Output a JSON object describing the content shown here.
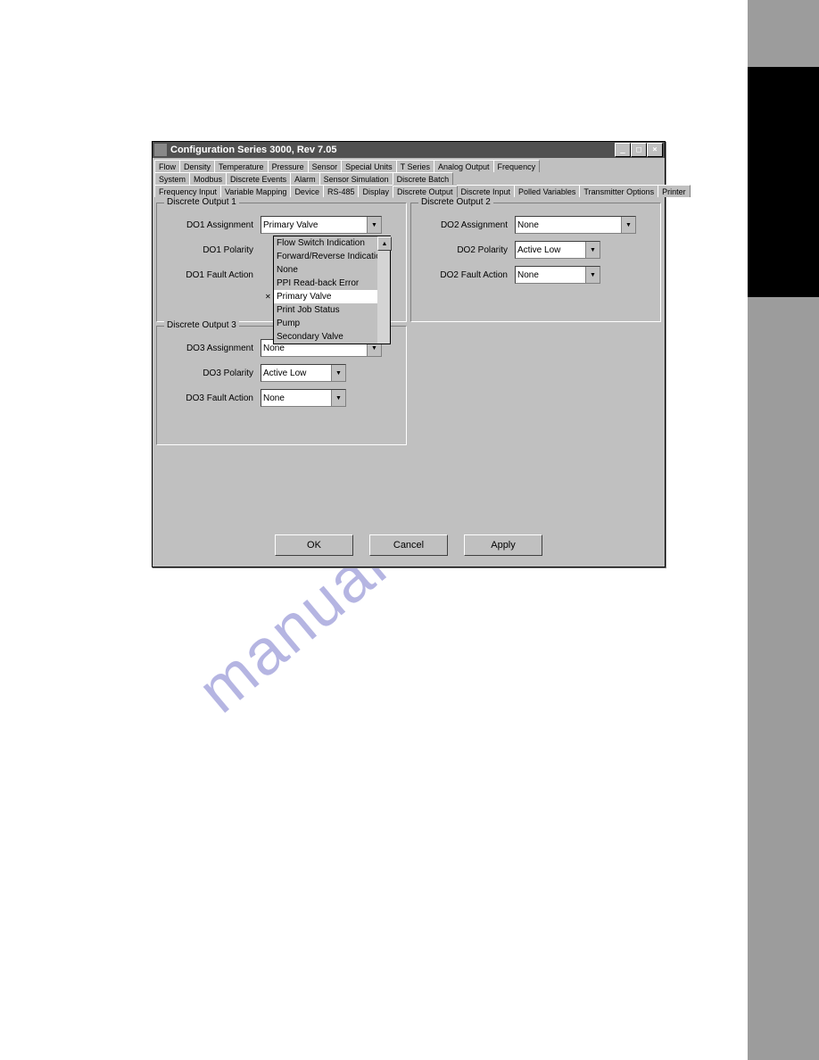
{
  "watermark": "manualshive.com",
  "window": {
    "title": "Configuration Series 3000, Rev 7.05"
  },
  "tabs": {
    "row1": [
      "Flow",
      "Density",
      "Temperature",
      "Pressure",
      "Sensor",
      "Special Units",
      "T Series",
      "Analog Output",
      "Frequency"
    ],
    "row2": [
      "System",
      "Modbus",
      "Discrete Events",
      "Alarm",
      "Sensor Simulation",
      "Discrete Batch"
    ],
    "row3": [
      "Frequency Input",
      "Variable Mapping",
      "Device",
      "RS-485",
      "Display",
      "Discrete Output",
      "Discrete Input",
      "Polled Variables",
      "Transmitter Options",
      "Printer"
    ]
  },
  "groups": {
    "do1": {
      "title": "Discrete Output 1",
      "assignment_label": "DO1 Assignment",
      "assignment_value": "Primary Valve",
      "polarity_label": "DO1 Polarity",
      "fault_label": "DO1 Fault Action",
      "dropdown_options": [
        "Flow Switch Indication",
        "Forward/Reverse Indication",
        "None",
        "PPI Read-back Error",
        "Primary Valve",
        "Print Job Status",
        "Pump",
        "Secondary Valve"
      ],
      "dropdown_selected": "Primary Valve"
    },
    "do2": {
      "title": "Discrete Output 2",
      "assignment_label": "DO2 Assignment",
      "assignment_value": "None",
      "polarity_label": "DO2 Polarity",
      "polarity_value": "Active Low",
      "fault_label": "DO2 Fault Action",
      "fault_value": "None"
    },
    "do3": {
      "title": "Discrete Output 3",
      "assignment_label": "DO3 Assignment",
      "assignment_value": "None",
      "polarity_label": "DO3 Polarity",
      "polarity_value": "Active Low",
      "fault_label": "DO3 Fault Action",
      "fault_value": "None"
    }
  },
  "buttons": {
    "ok": "OK",
    "cancel": "Cancel",
    "apply": "Apply"
  }
}
